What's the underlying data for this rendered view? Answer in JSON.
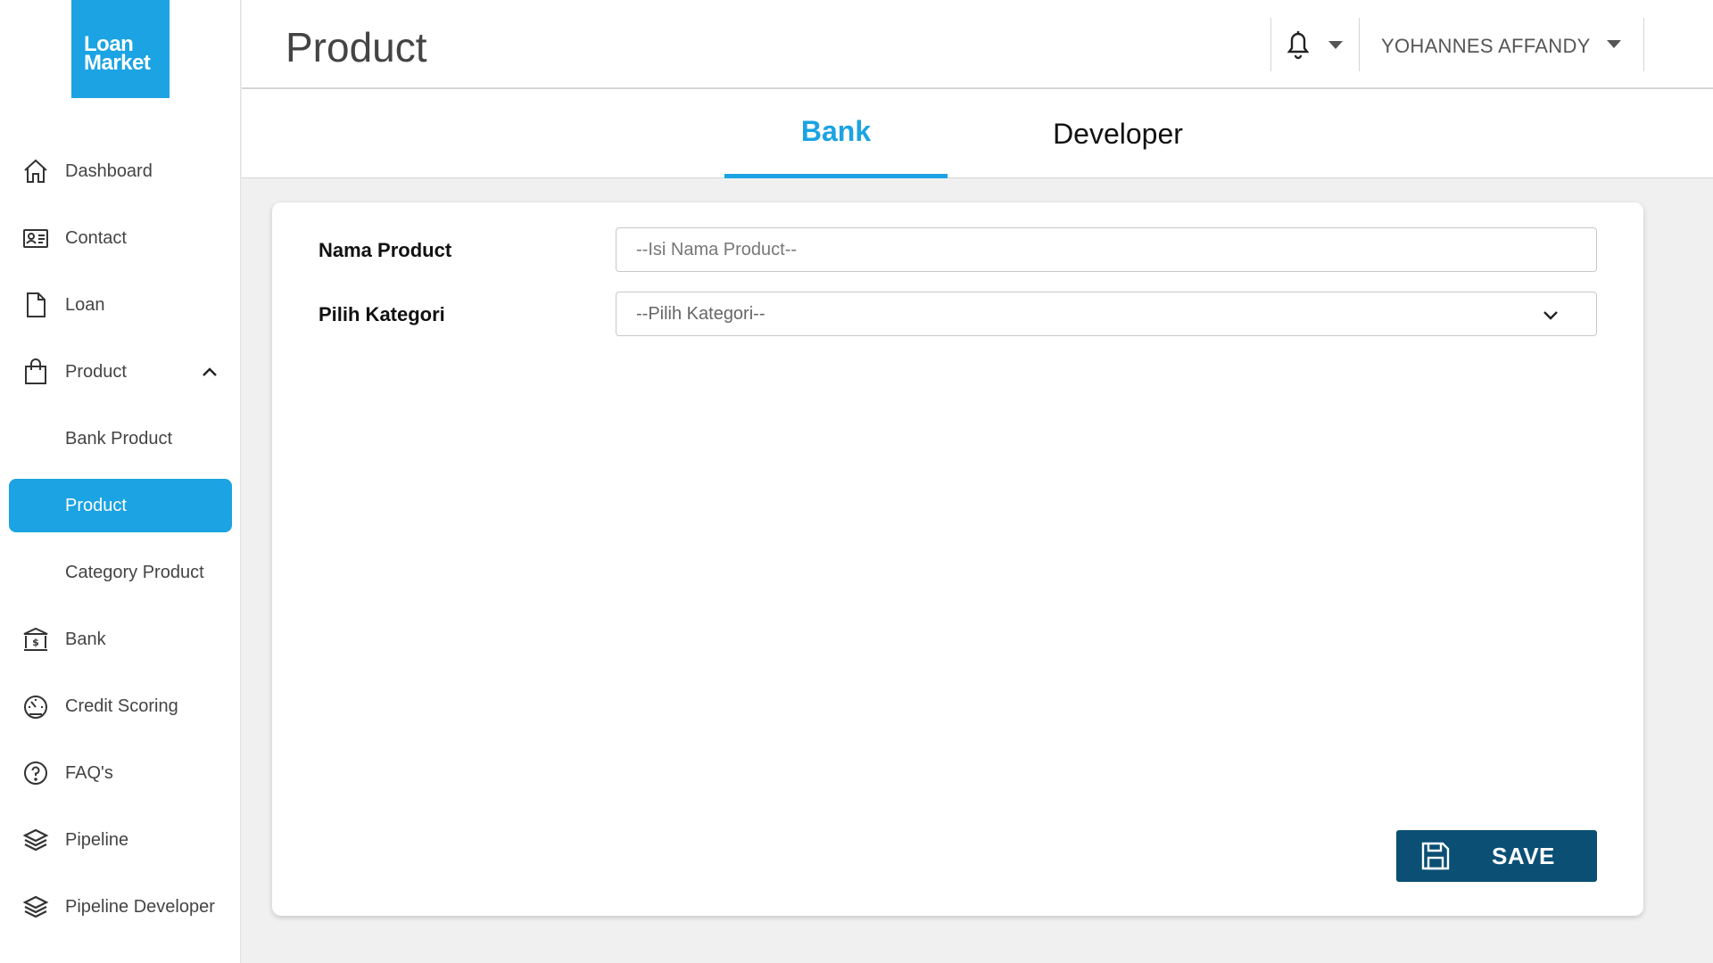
{
  "logo": {
    "line1": "Loan",
    "line2": "Market"
  },
  "sidebar": {
    "items": [
      {
        "label": "Dashboard",
        "icon": "home-icon"
      },
      {
        "label": "Contact",
        "icon": "contact-card-icon"
      },
      {
        "label": "Loan",
        "icon": "document-icon"
      },
      {
        "label": "Product",
        "icon": "shopping-bag-icon",
        "expanded": true
      },
      {
        "label": "Bank Product"
      },
      {
        "label": "Product",
        "active": true
      },
      {
        "label": "Category Product"
      },
      {
        "label": "Bank",
        "icon": "bank-icon"
      },
      {
        "label": "Credit Scoring",
        "icon": "gauge-icon"
      },
      {
        "label": "FAQ's",
        "icon": "help-circle-icon"
      },
      {
        "label": "Pipeline",
        "icon": "layers-icon"
      },
      {
        "label": "Pipeline Developer",
        "icon": "layers-icon"
      }
    ]
  },
  "header": {
    "title": "Product",
    "user_name": "YOHANNES AFFANDY"
  },
  "tabs": [
    {
      "label": "Bank",
      "active": true
    },
    {
      "label": "Developer",
      "active": false
    }
  ],
  "form": {
    "nama_product_label": "Nama Product",
    "nama_product_placeholder": "--Isi Nama Product--",
    "nama_product_value": "",
    "kategori_label": "Pilih Kategori",
    "kategori_selected": "--Pilih Kategori--"
  },
  "actions": {
    "save_label": "SAVE"
  },
  "colors": {
    "accent": "#1ba3e3",
    "save_button": "#0b4f75",
    "background": "#f0f0f0"
  }
}
